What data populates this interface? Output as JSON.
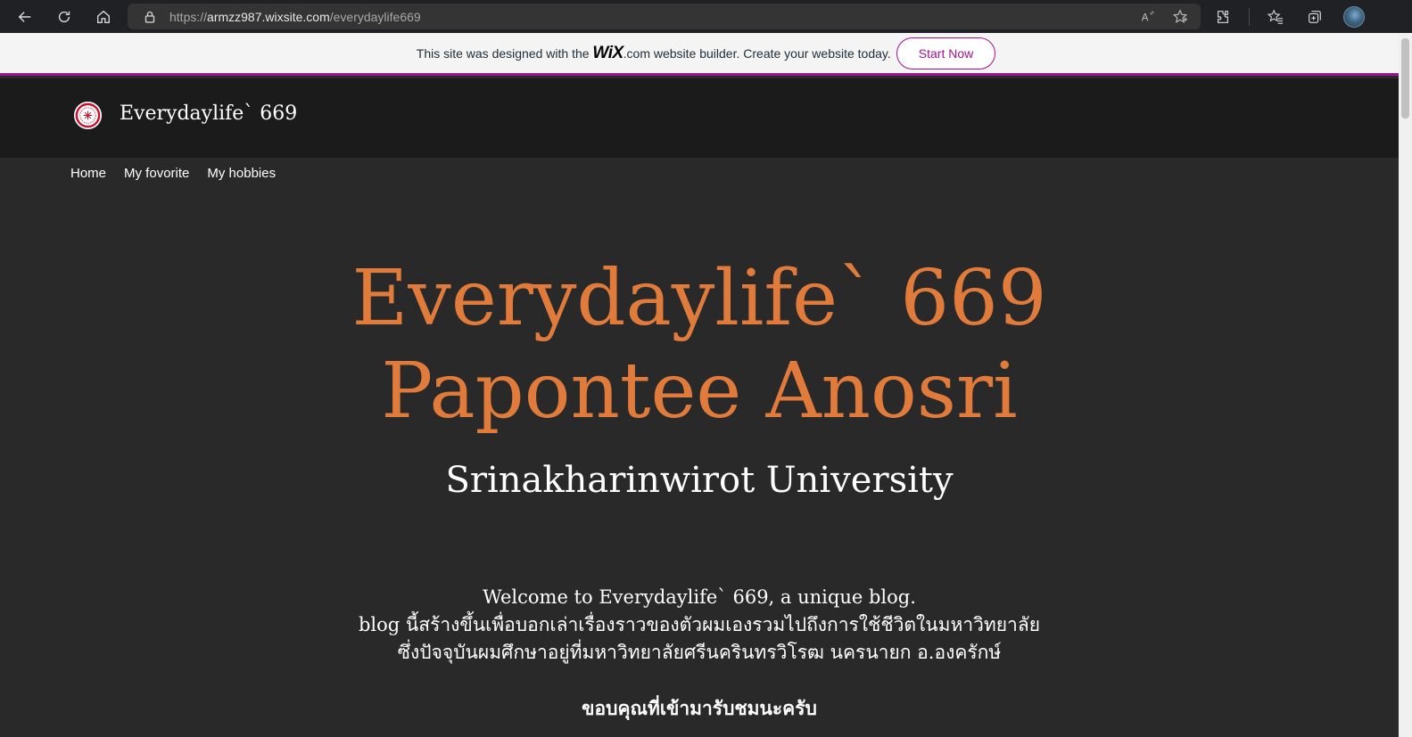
{
  "browser": {
    "url_prefix": "https://",
    "url_host": "armzz987.wixsite.com",
    "url_path": "/everydaylife669",
    "icons": [
      "back-icon",
      "refresh-icon",
      "home-icon",
      "lock-icon",
      "read-aloud-icon",
      "add-favorite-icon",
      "extensions-icon",
      "favorites-icon",
      "collections-icon",
      "profile-avatar"
    ]
  },
  "wix_banner": {
    "text_before": "This site was designed with the ",
    "logo": "WiX",
    "logo_suffix": ".com",
    "text_after": " website builder. Create your website today.",
    "button_label": "Start Now",
    "accent_color": "#a0138e"
  },
  "site": {
    "name": "Everydaylife` 669",
    "nav": [
      "Home",
      "My fovorite",
      "My hobbies"
    ]
  },
  "hero": {
    "title_line1": "Everydaylife` 669",
    "title_line2": "Papontee Anosri",
    "subtitle": "Srinakharinwirot University",
    "title_color": "#e07b3c"
  },
  "intro": {
    "line1": "Welcome to Everydaylife` 669, a unique blog.",
    "line2": "blog นี้สร้างขึ้นเพื่อบอกเล่าเรื่องราวของตัวผมเองรวมไปถึงการใช้ชีวิตในมหาวิทยาลัย",
    "line3": "ซึ่งปัจจุบันผมศึกษาอยู่ที่มหาวิทยาลัยศรีนครินทรวิโรฒ นครนายก อ.องครักษ์",
    "thanks": "ขอบคุณที่เข้ามารับชมนะครับ"
  }
}
